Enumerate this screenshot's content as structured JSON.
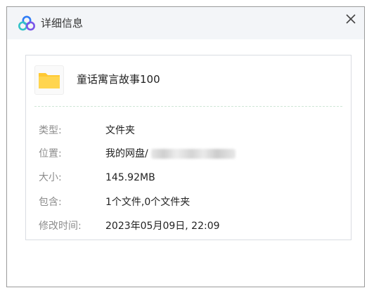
{
  "dialog": {
    "title": "详细信息",
    "close_icon": "close-icon",
    "logo_icon": "baidu-netdisk-logo-icon"
  },
  "file": {
    "name": "童话寓言故事100",
    "icon": "folder-icon"
  },
  "details": [
    {
      "label": "类型:",
      "value": "文件夹"
    },
    {
      "label": "位置:",
      "value": "我的网盘/"
    },
    {
      "label": "大小:",
      "value": "145.92MB"
    },
    {
      "label": "包含:",
      "value": "1个文件,0个文件夹"
    },
    {
      "label": "修改时间:",
      "value": "2023年05月09日, 22:09"
    }
  ],
  "colors": {
    "folder": "#FFC933",
    "logo_blue": "#2E7CF6",
    "logo_teal": "#33C3C8",
    "logo_purple": "#7A56E8"
  }
}
